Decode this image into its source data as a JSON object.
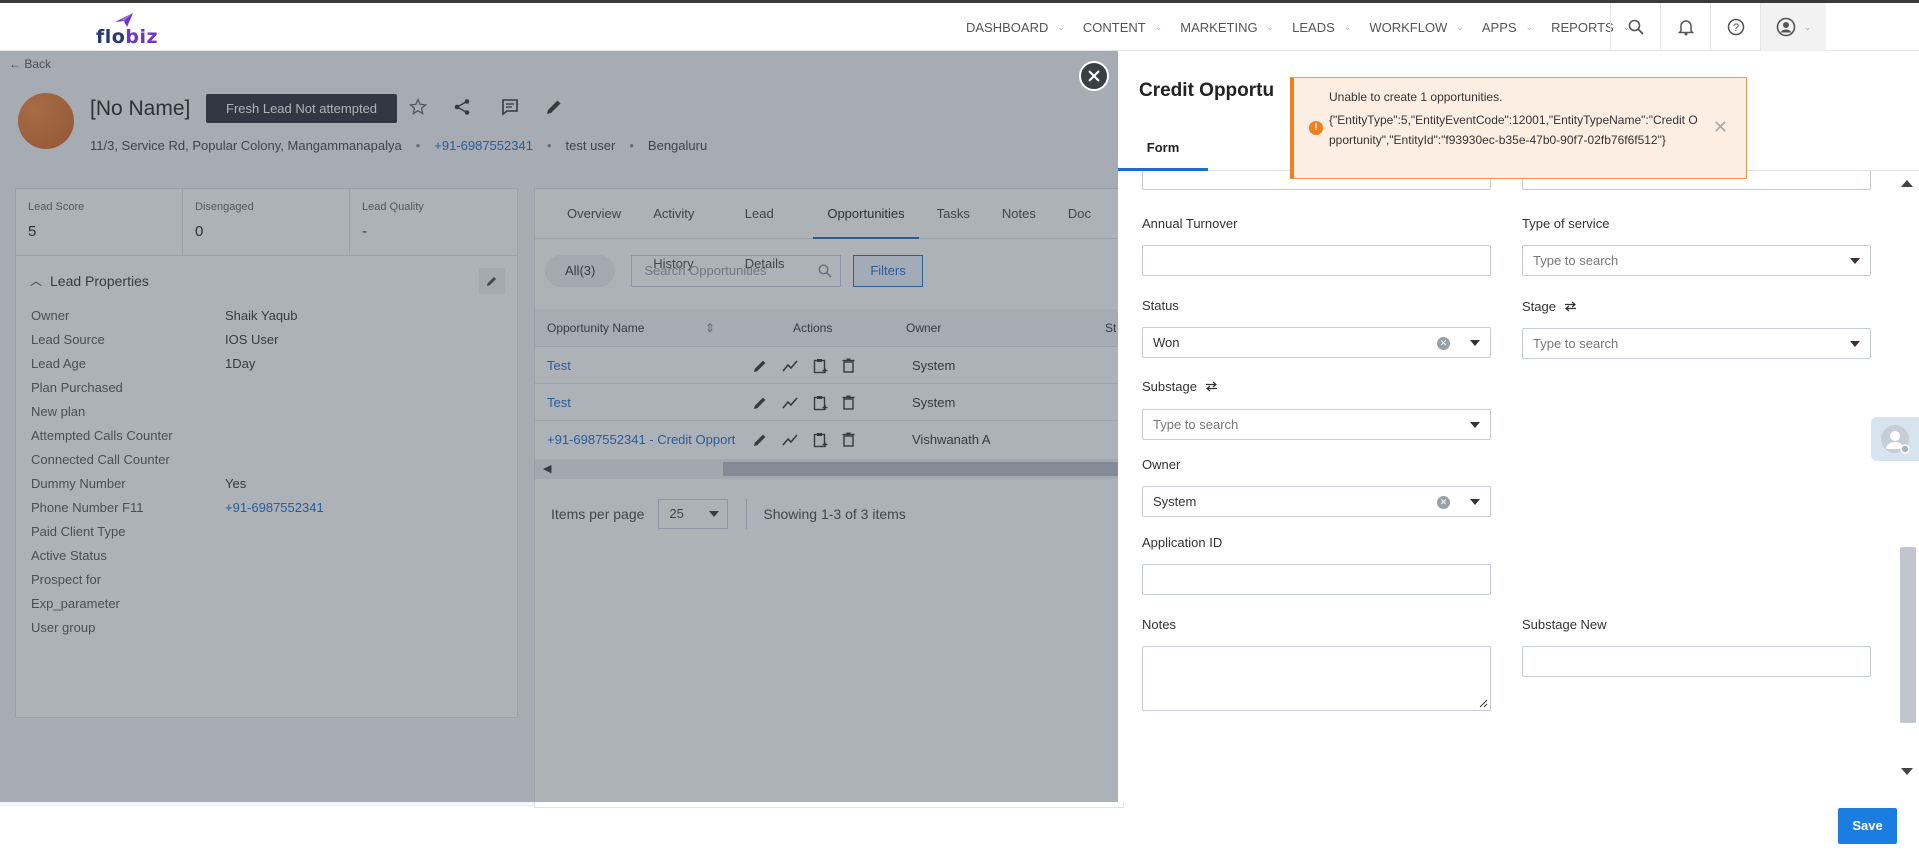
{
  "brand": {
    "logo_prefix": "flo",
    "logo_suffix": "biz"
  },
  "nav": {
    "items": [
      "DASHBOARD",
      "CONTENT",
      "MARKETING",
      "LEADS",
      "WORKFLOW",
      "APPS",
      "REPORTS"
    ],
    "icons": [
      "search-icon",
      "bell-icon",
      "help-icon",
      "user-icon"
    ]
  },
  "lead": {
    "back": "Back",
    "name": "[No Name]",
    "status_badge": "Fresh Lead Not attempted",
    "address": "11/3, Service Rd, Popular Colony, Mangammanapalya",
    "phone": "+91-6987552341",
    "user": "test user",
    "city": "Bengaluru"
  },
  "scores": [
    {
      "label": "Lead Score",
      "value": "5"
    },
    {
      "label": "Disengaged",
      "value": "0"
    },
    {
      "label": "Lead Quality",
      "value": "-"
    }
  ],
  "properties": {
    "title": "Lead Properties",
    "rows": [
      {
        "label": "Owner",
        "value": "Shaik Yaqub"
      },
      {
        "label": "Lead Source",
        "value": "IOS User"
      },
      {
        "label": "Lead Age",
        "value": "1Day"
      },
      {
        "label": "Plan Purchased",
        "value": ""
      },
      {
        "label": "New plan",
        "value": ""
      },
      {
        "label": "Attempted Calls Counter",
        "value": ""
      },
      {
        "label": "Connected Call Counter",
        "value": ""
      },
      {
        "label": "Dummy Number",
        "value": "Yes"
      },
      {
        "label": "Phone Number F11",
        "value": "+91-6987552341"
      },
      {
        "label": "Paid Client Type",
        "value": ""
      },
      {
        "label": "Active Status",
        "value": ""
      },
      {
        "label": "Prospect for",
        "value": ""
      },
      {
        "label": "Exp_parameter",
        "value": ""
      },
      {
        "label": "User group",
        "value": ""
      }
    ]
  },
  "tabs": [
    "Overview",
    "Activity History",
    "Lead Details",
    "Opportunities",
    "Tasks",
    "Notes",
    "Doc"
  ],
  "opportunities": {
    "all_chip": "All(3)",
    "search_placeholder": "Search Opportunities",
    "filters": "Filters",
    "columns": [
      "Opportunity Name",
      "Actions",
      "Owner",
      "St"
    ],
    "rows": [
      {
        "name": "Test",
        "owner": "System"
      },
      {
        "name": "Test",
        "owner": "System"
      },
      {
        "name": "+91-6987552341 - Credit Opport",
        "owner": "Vishwanath A"
      }
    ],
    "items_per_page_label": "Items per page",
    "items_per_page": "25",
    "showing": "Showing 1-3 of 3 items"
  },
  "drawer": {
    "title": "Credit Opportu",
    "tab": "Form",
    "fields": {
      "annual_turnover": {
        "label": "Annual Turnover",
        "value": ""
      },
      "type_of_service": {
        "label": "Type of service",
        "placeholder": "Type to search"
      },
      "status": {
        "label": "Status",
        "value": "Won"
      },
      "stage": {
        "label": "Stage",
        "placeholder": "Type to search"
      },
      "substage": {
        "label": "Substage",
        "placeholder": "Type to search"
      },
      "owner": {
        "label": "Owner",
        "value": "System"
      },
      "application_id": {
        "label": "Application ID",
        "value": ""
      },
      "notes": {
        "label": "Notes",
        "value": ""
      },
      "substage_new": {
        "label": "Substage New",
        "value": ""
      }
    },
    "save": "Save"
  },
  "toast": {
    "title": "Unable to create 1 opportunities.",
    "message": "{\"EntityType\":5,\"EntityEventCode\":12001,\"EntityTypeName\":\"Credit Opportunity\",\"EntityId\":\"f93930ec-b35e-47b0-90f7-02fb76f6f512\"}",
    "color": "#f07f1f"
  }
}
